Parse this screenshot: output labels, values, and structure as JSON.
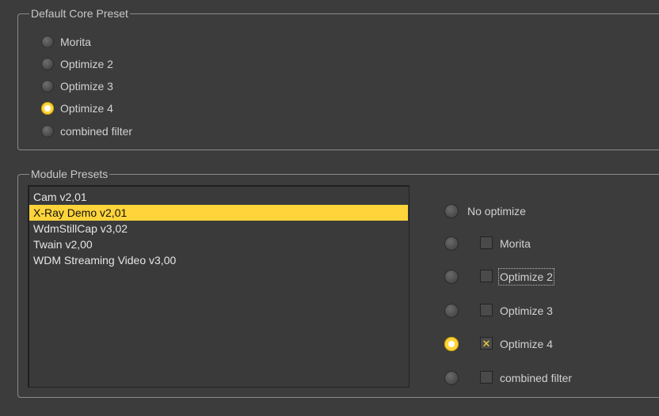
{
  "default_core_preset": {
    "title": "Default Core Preset",
    "options": [
      {
        "label": "Morita",
        "checked": false
      },
      {
        "label": "Optimize 2",
        "checked": false
      },
      {
        "label": "Optimize 3",
        "checked": false
      },
      {
        "label": "Optimize 4",
        "checked": true
      },
      {
        "label": "combined filter",
        "checked": false
      }
    ]
  },
  "module_presets": {
    "title": "Module Presets",
    "modules": [
      {
        "label": "Cam v2,01",
        "selected": false
      },
      {
        "label": "X-Ray Demo v2,01",
        "selected": true
      },
      {
        "label": "WdmStillCap v3,02",
        "selected": false
      },
      {
        "label": "Twain v2,00",
        "selected": false
      },
      {
        "label": "WDM Streaming Video v3,00",
        "selected": false
      }
    ],
    "no_optimize_label": "No optimize",
    "optimizations": [
      {
        "label": "Morita",
        "radio_checked": false,
        "checkbox_checked": false,
        "focused": false
      },
      {
        "label": "Optimize 2",
        "radio_checked": false,
        "checkbox_checked": false,
        "focused": true
      },
      {
        "label": "Optimize 3",
        "radio_checked": false,
        "checkbox_checked": false,
        "focused": false
      },
      {
        "label": "Optimize 4",
        "radio_checked": true,
        "checkbox_checked": true,
        "focused": false
      },
      {
        "label": "combined filter",
        "radio_checked": false,
        "checkbox_checked": false,
        "focused": false
      }
    ]
  },
  "colors": {
    "background": "#3c3c3c",
    "accent": "#ffd43b",
    "text": "#d2d2d2"
  }
}
